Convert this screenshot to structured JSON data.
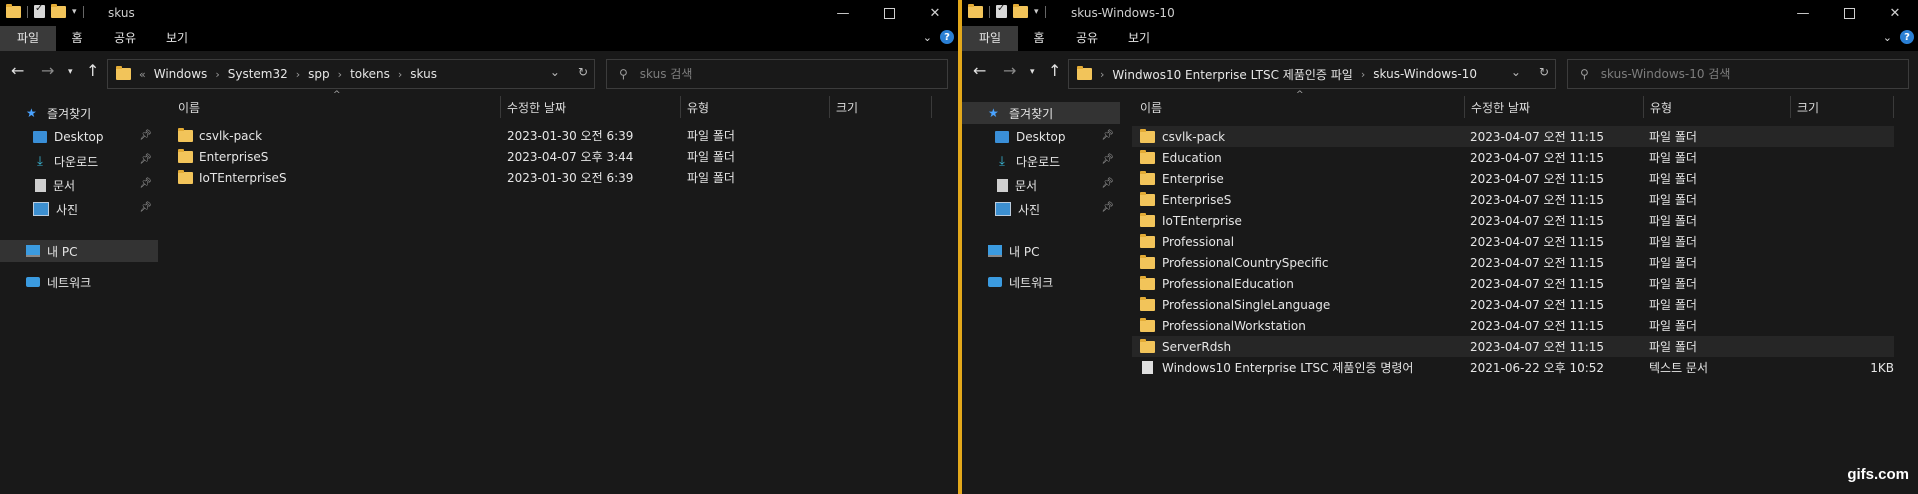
{
  "left": {
    "title": "skus",
    "ribbon_tabs": [
      "파일",
      "홈",
      "공유",
      "보기"
    ],
    "breadcrumb": [
      "Windows",
      "System32",
      "spp",
      "tokens",
      "skus"
    ],
    "search_placeholder": "skus 검색",
    "nav": {
      "quick_access": "즐겨찾기",
      "desktop": "Desktop",
      "downloads": "다운로드",
      "documents": "문서",
      "pictures": "사진",
      "this_pc": "내 PC",
      "network": "네트워크"
    },
    "columns": [
      "이름",
      "수정한 날짜",
      "유형",
      "크기"
    ],
    "files": [
      {
        "name": "csvlk-pack",
        "date": "2023-01-30 오전 6:39",
        "type": "파일 폴더",
        "size": ""
      },
      {
        "name": "EnterpriseS",
        "date": "2023-04-07 오후 3:44",
        "type": "파일 폴더",
        "size": ""
      },
      {
        "name": "IoTEnterpriseS",
        "date": "2023-01-30 오전 6:39",
        "type": "파일 폴더",
        "size": ""
      }
    ]
  },
  "right": {
    "title": "skus-Windows-10",
    "ribbon_tabs": [
      "파일",
      "홈",
      "공유",
      "보기"
    ],
    "breadcrumb": [
      "Windwos10 Enterprise LTSC 제품인증 파일",
      "skus-Windows-10"
    ],
    "search_placeholder": "skus-Windows-10 검색",
    "nav": {
      "quick_access": "즐겨찾기",
      "desktop": "Desktop",
      "downloads": "다운로드",
      "documents": "문서",
      "pictures": "사진",
      "this_pc": "내 PC",
      "network": "네트워크"
    },
    "columns": [
      "이름",
      "수정한 날짜",
      "유형",
      "크기"
    ],
    "files": [
      {
        "name": "csvlk-pack",
        "date": "2023-04-07 오전 11:15",
        "type": "파일 폴더",
        "size": "",
        "kind": "folder"
      },
      {
        "name": "Education",
        "date": "2023-04-07 오전 11:15",
        "type": "파일 폴더",
        "size": "",
        "kind": "folder"
      },
      {
        "name": "Enterprise",
        "date": "2023-04-07 오전 11:15",
        "type": "파일 폴더",
        "size": "",
        "kind": "folder"
      },
      {
        "name": "EnterpriseS",
        "date": "2023-04-07 오전 11:15",
        "type": "파일 폴더",
        "size": "",
        "kind": "folder"
      },
      {
        "name": "IoTEnterprise",
        "date": "2023-04-07 오전 11:15",
        "type": "파일 폴더",
        "size": "",
        "kind": "folder"
      },
      {
        "name": "Professional",
        "date": "2023-04-07 오전 11:15",
        "type": "파일 폴더",
        "size": "",
        "kind": "folder"
      },
      {
        "name": "ProfessionalCountrySpecific",
        "date": "2023-04-07 오전 11:15",
        "type": "파일 폴더",
        "size": "",
        "kind": "folder"
      },
      {
        "name": "ProfessionalEducation",
        "date": "2023-04-07 오전 11:15",
        "type": "파일 폴더",
        "size": "",
        "kind": "folder"
      },
      {
        "name": "ProfessionalSingleLanguage",
        "date": "2023-04-07 오전 11:15",
        "type": "파일 폴더",
        "size": "",
        "kind": "folder"
      },
      {
        "name": "ProfessionalWorkstation",
        "date": "2023-04-07 오전 11:15",
        "type": "파일 폴더",
        "size": "",
        "kind": "folder"
      },
      {
        "name": "ServerRdsh",
        "date": "2023-04-07 오전 11:15",
        "type": "파일 폴더",
        "size": "",
        "kind": "folder"
      },
      {
        "name": "Windows10 Enterprise LTSC 제품인증 명령어",
        "date": "2021-06-22 오후 10:52",
        "type": "텍스트 문서",
        "size": "1KB",
        "kind": "text"
      }
    ]
  },
  "watermark": "gifs.com",
  "accent_color": "#e3a81b",
  "folder_color": "#f2c45a"
}
